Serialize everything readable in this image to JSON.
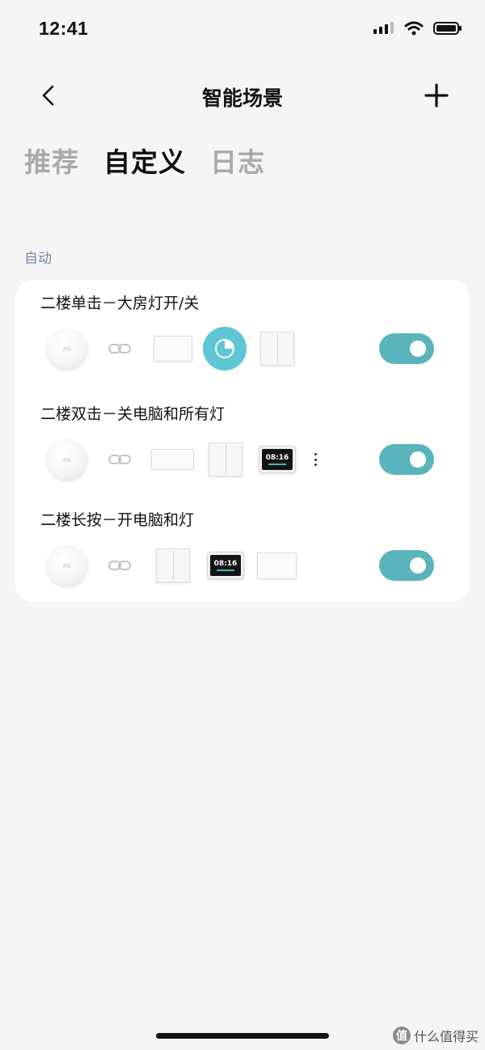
{
  "status_bar": {
    "time": "12:41"
  },
  "header": {
    "title": "智能场景"
  },
  "tabs": [
    {
      "label": "推荐",
      "active": false
    },
    {
      "label": "自定义",
      "active": true
    },
    {
      "label": "日志",
      "active": false
    }
  ],
  "section": {
    "label": "自动"
  },
  "scenes": [
    {
      "title": "二楼单击－大房灯开/关",
      "enabled": true
    },
    {
      "title": "二楼双击－关电脑和所有灯",
      "enabled": true
    },
    {
      "title": "二楼长按－开电脑和灯",
      "enabled": true
    }
  ],
  "devices": {
    "button_logo": "mi",
    "clock_time": "08:16"
  },
  "watermark": {
    "logo": "值",
    "text": "什么值得买"
  },
  "colors": {
    "accent": "#5ab4bc",
    "timer": "#5ec6d4",
    "background": "#f5f5f5"
  }
}
